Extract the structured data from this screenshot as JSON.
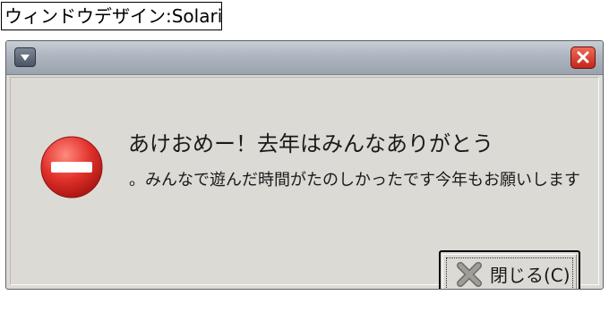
{
  "caption": "ウィンドウデザイン:Solaris",
  "window": {
    "menu_icon": "chevron-down-icon",
    "close_icon": "close-icon"
  },
  "dialog": {
    "icon": "error-stop-icon",
    "headline": "あけおめー！去年はみんなありがとう",
    "message": "。みんなで遊んだ時間がたのしかったです今年もお願いします",
    "close_button": {
      "label": "閉じる(C)",
      "icon": "x-icon"
    }
  },
  "colors": {
    "dialog_background": "#dcdad5",
    "titlebar": "#aeb5bf",
    "close_button": "#c4261a",
    "stop_icon": "#e1302a"
  }
}
